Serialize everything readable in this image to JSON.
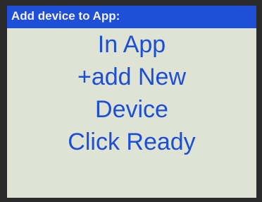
{
  "screen": {
    "title": "Add device to App:",
    "lines": [
      "In App",
      "+add New",
      "Device",
      "Click Ready"
    ]
  },
  "colors": {
    "title_bar": "#1f4fd6",
    "title_text": "#f2f2f2",
    "background": "#dfe3d4",
    "body_text": "#1b4fd8",
    "bezel": "#2a2a2a"
  }
}
